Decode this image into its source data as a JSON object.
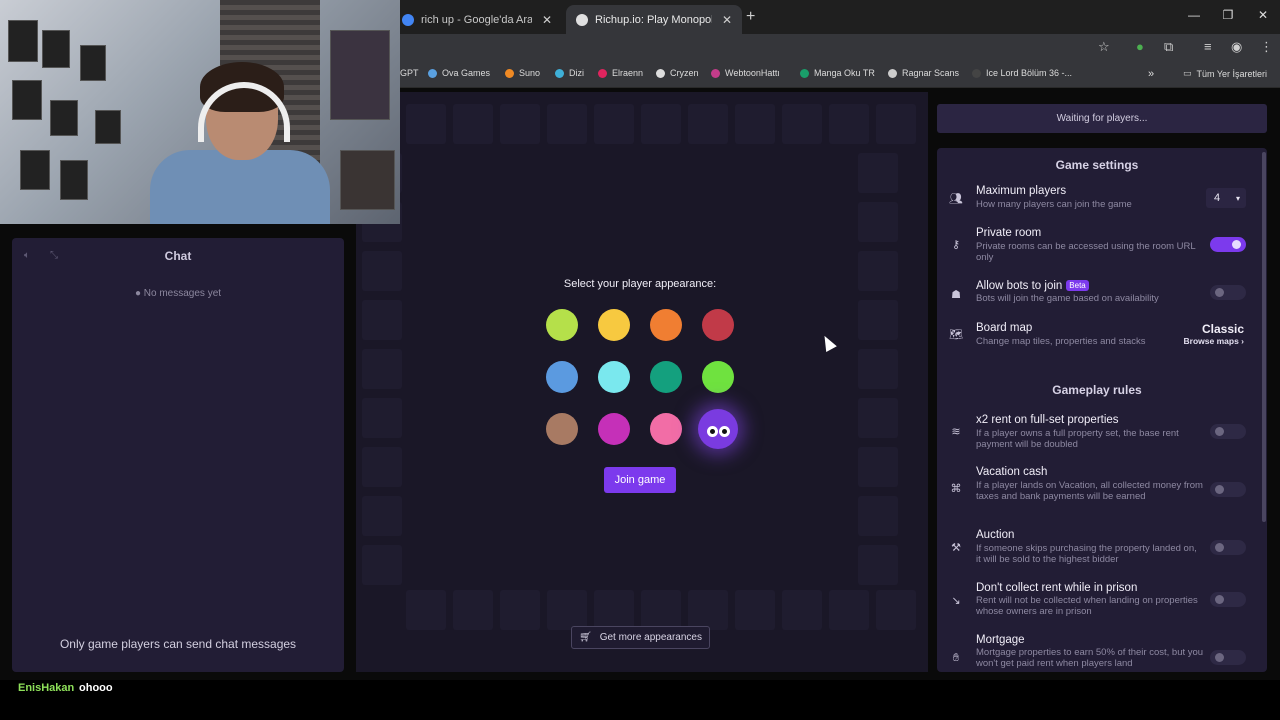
{
  "browser": {
    "tabs": [
      {
        "title": "rich up - Google'da Ara",
        "favicon_color": "#4285f4",
        "active": false
      },
      {
        "title": "Richup.io: Play Monopoly Alternative",
        "favicon_color": "#e0e0e0",
        "active": true
      }
    ],
    "tab_close_glyph": "✕",
    "new_tab_glyph": "+",
    "window_controls": [
      "—",
      "❐",
      "✕"
    ],
    "toolbar_icons": [
      "star-icon",
      "extension-icon",
      "puzzle-icon",
      "media-icon",
      "profile-icon",
      "menu-icon"
    ],
    "bookmarks": [
      {
        "label": "GPT",
        "color": "#888888"
      },
      {
        "label": "Ova Games",
        "color": "#5aa0e0"
      },
      {
        "label": "Suno",
        "color": "#f08a24"
      },
      {
        "label": "Dizi",
        "color": "#3fb0d8"
      },
      {
        "label": "Elraenn",
        "color": "#e0245e"
      },
      {
        "label": "Cryzen",
        "color": "#dddddd"
      },
      {
        "label": "WebtoonHattı",
        "color": "#c43c8a"
      },
      {
        "label": "Manga Oku TR",
        "color": "#1a9e6a"
      },
      {
        "label": "Ragnar Scans",
        "color": "#cccccc"
      },
      {
        "label": "Ice Lord Bölüm 36 -...",
        "color": "#444444"
      }
    ],
    "overflow_glyph": "»",
    "all_bookmarks": "Tüm Yer İşaretleri"
  },
  "chat": {
    "title": "Chat",
    "empty_text": "No messages yet",
    "footer": "Only game players can send chat messages",
    "icons": [
      "volume-icon",
      "collapse-icon"
    ]
  },
  "lobby": {
    "appearance_title": "Select your player appearance:",
    "colors": [
      "#b5e04a",
      "#f7c940",
      "#f07e32",
      "#c13a48",
      "#5b9ae0",
      "#7ae8ee",
      "#14a07e",
      "#6fe23f",
      "#a87a63",
      "#c530b8",
      "#f26da6",
      "#7a3be0"
    ],
    "selected_index": 11,
    "join_label": "Join game",
    "more_label": "Get more appearances"
  },
  "status": {
    "waiting": "Waiting for players..."
  },
  "settings": {
    "game_title": "Game settings",
    "rules_title": "Gameplay rules",
    "max_players": {
      "title": "Maximum players",
      "desc": "How many players can join the game",
      "value": "4"
    },
    "private_room": {
      "title": "Private room",
      "desc": "Private rooms can be accessed using the room URL only",
      "on": true
    },
    "bots": {
      "title": "Allow bots to join",
      "badge": "Beta",
      "desc": "Bots will join the game based on availability",
      "on": false
    },
    "board_map": {
      "title": "Board map",
      "desc": "Change map tiles, properties and stacks",
      "value": "Classic",
      "link": "Browse maps ›"
    },
    "x2_rent": {
      "title": "x2 rent on full-set properties",
      "desc": "If a player owns a full property set, the base rent payment will be doubled",
      "on": false
    },
    "vacation": {
      "title": "Vacation cash",
      "desc": "If a player lands on Vacation, all collected money from taxes and bank payments will be earned",
      "on": false
    },
    "auction": {
      "title": "Auction",
      "desc": "If someone skips purchasing the property landed on, it will be sold to the highest bidder",
      "on": false
    },
    "prison_rent": {
      "title": "Don't collect rent while in prison",
      "desc": "Rent will not be collected when landing on properties whose owners are in prison",
      "on": false
    },
    "mortgage": {
      "title": "Mortgage",
      "desc": "Mortgage properties to earn 50% of their cost, but you won't get paid rent when players land",
      "on": false
    }
  },
  "stream_chat": {
    "user": "EnisHakan",
    "message": "ohooo"
  }
}
